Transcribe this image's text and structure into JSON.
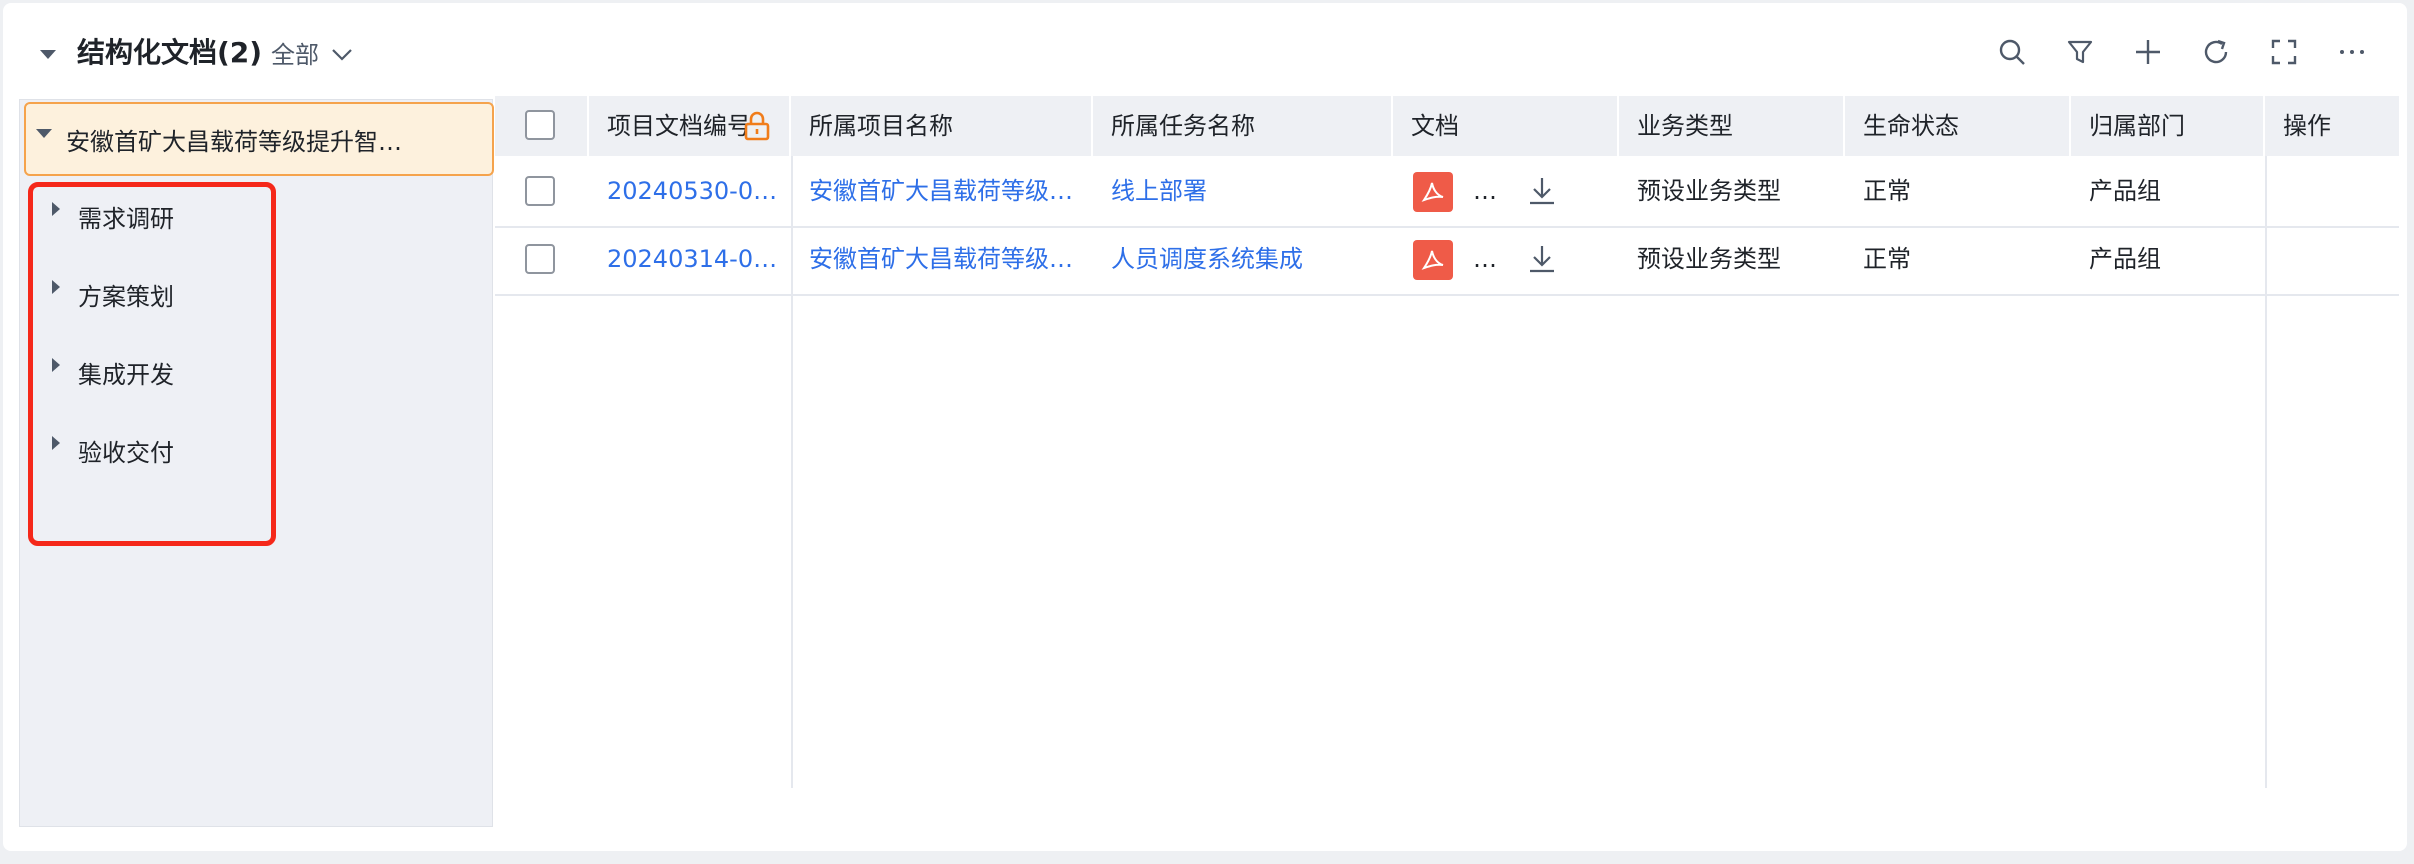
{
  "header": {
    "title": "结构化文档(2)",
    "filter_label": "全部",
    "tools": [
      "search-icon",
      "filter-icon",
      "plus-icon",
      "refresh-icon",
      "fullscreen-icon",
      "more-icon"
    ]
  },
  "tree": {
    "root_label": "安徽首矿大昌载荷等级提升智…",
    "items": [
      {
        "label": "需求调研"
      },
      {
        "label": "方案策划"
      },
      {
        "label": "集成开发"
      },
      {
        "label": "验收交付"
      }
    ]
  },
  "table": {
    "columns": [
      "项目文档编号",
      "所属项目名称",
      "所属任务名称",
      "文档",
      "业务类型",
      "生命状态",
      "归属部门",
      "操作"
    ],
    "rows": [
      {
        "code": "20240530-00…",
        "project": "安徽首矿大昌载荷等级…",
        "task": "线上部署",
        "doc_name": "…",
        "biz_type": "预设业务类型",
        "status": "正常",
        "dept": "产品组"
      },
      {
        "code": "20240314-00…",
        "project": "安徽首矿大昌载荷等级…",
        "task": "人员调度系统集成",
        "doc_name": "…",
        "biz_type": "预设业务类型",
        "status": "正常",
        "dept": "产品组"
      }
    ]
  },
  "colors": {
    "accent_link": "#2e6fe8",
    "tree_selected_bg": "#fdf1dd",
    "tree_selected_border": "#f5a34c",
    "highlight_box": "#f5281a",
    "pdf_icon": "#ef5b48",
    "lock_icon": "#f07c1a"
  }
}
